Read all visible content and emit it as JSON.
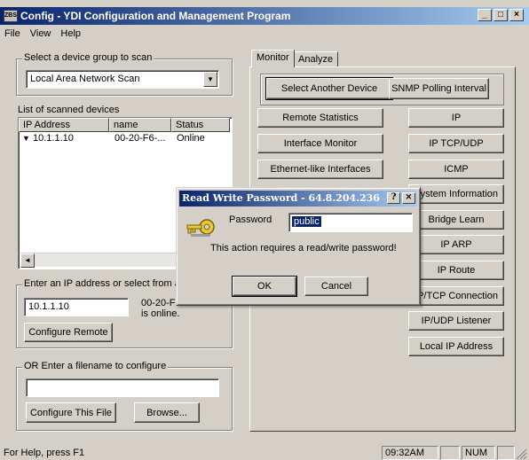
{
  "window": {
    "title": "Config - YDI Configuration and Management Program",
    "app_icon_text": "ZBS",
    "controls": {
      "minimize": "_",
      "maximize": "□",
      "close": "×"
    }
  },
  "menu": [
    "File",
    "View",
    "Help"
  ],
  "left": {
    "device_group": {
      "label": "Select a device group to scan",
      "selected": "Local Area Network Scan"
    },
    "list": {
      "label": "List of scanned devices",
      "columns": [
        "IP Address",
        "name",
        "Status"
      ],
      "rows": [
        {
          "ip": "10.1.1.10",
          "name": "00-20-F6-...",
          "status": "Online"
        }
      ]
    },
    "ip_group": {
      "label": "Enter an IP address or select from al",
      "ip_value": "10.1.1.10",
      "info_line1": "00-20-F",
      "info_line2": "is online.",
      "configure_remote": "Configure Remote"
    },
    "file_group": {
      "label": "OR Enter a filename to configure",
      "filename": "",
      "configure_file": "Configure This File",
      "browse": "Browse..."
    }
  },
  "right": {
    "tabs": [
      "Monitor",
      "Analyze"
    ],
    "active_tab": "Monitor",
    "top_buttons": [
      "Select Another Device",
      "SNMP Polling Interval"
    ],
    "left_buttons": [
      "Remote Statistics",
      "Interface Monitor",
      "Ethernet-like Interfaces"
    ],
    "right_buttons": [
      "IP",
      "IP TCP/UDP",
      "ICMP",
      "ystem Information",
      "Bridge Learn",
      "IP ARP",
      "IP Route",
      "P/TCP Connection",
      "IP/UDP Listener",
      "Local IP Address"
    ]
  },
  "dialog": {
    "title": "Read Write Password - 64.8.204.236",
    "help_btn": "?",
    "close_btn": "×",
    "password_label": "Password",
    "password_value": "public",
    "message": "This action requires a read/write password!",
    "ok": "OK",
    "cancel": "Cancel"
  },
  "status": {
    "help": "For Help, press F1",
    "time": "09:32AM",
    "num": "NUM"
  }
}
